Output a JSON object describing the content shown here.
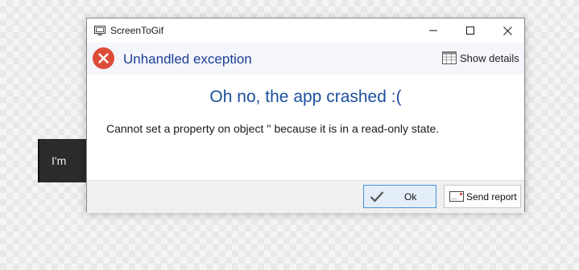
{
  "background_app": {
    "label": "I'm"
  },
  "window": {
    "title": "ScreenToGif",
    "controls": {
      "minimize": "minimize",
      "maximize": "maximize",
      "close": "close"
    }
  },
  "header": {
    "icon": "error-icon",
    "title": "Unhandled exception",
    "show_details_label": "Show details",
    "show_details_icon": "details-grid-icon"
  },
  "body": {
    "title": "Oh no, the app crashed :(",
    "message": "Cannot set a property on object '' because it is in a read-only state."
  },
  "footer": {
    "ok_label": "Ok",
    "ok_icon": "checkmark-icon",
    "report_label": "Send report",
    "report_icon": "envelope-icon"
  },
  "colors": {
    "accent_blue": "#1c3f94",
    "error_red": "#dd4b39",
    "ok_button_border": "#4a90d9"
  }
}
